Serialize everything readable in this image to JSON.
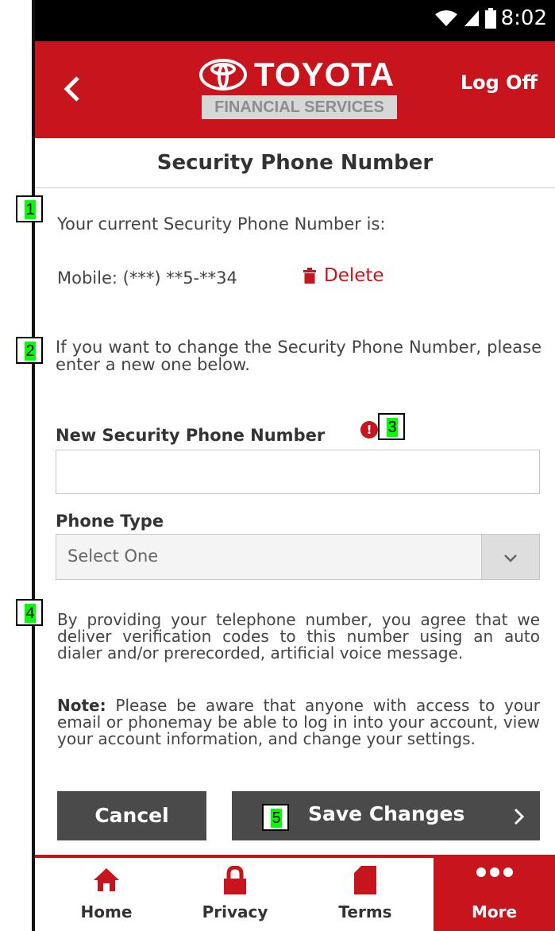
{
  "status_bar": {
    "time": "8:02"
  },
  "header": {
    "brand_name": "TOYOTA",
    "brand_sub": "FINANCIAL SERVICES",
    "logoff_label": "Log Off"
  },
  "page": {
    "title": "Security Phone Number"
  },
  "current": {
    "label": "Your current Security Phone Number is:",
    "mobile": "Mobile: (***) **5-**34",
    "delete_label": "Delete"
  },
  "change_text": "If you want to change the Security Phone Number, please enter a new one below.",
  "form": {
    "phone_label": "New Security Phone Number",
    "phone_value": "",
    "phone_type_label": "Phone Type",
    "phone_type_value": "Select One"
  },
  "consent_text": "By providing your telephone number, you agree that we deliver verification codes to this number using an auto dialer and/or prerecorded, artificial voice message.",
  "note": {
    "label": "Note:",
    "text": " Please be aware that anyone with access to your email or phonemay be able to log in into your account, view your account information, and change your settings."
  },
  "buttons": {
    "cancel": "Cancel",
    "save": "Save Changes"
  },
  "bottom_nav": [
    {
      "label": "Home",
      "icon": "home-icon"
    },
    {
      "label": "Privacy",
      "icon": "lock-icon"
    },
    {
      "label": "Terms",
      "icon": "document-icon"
    },
    {
      "label": "More",
      "icon": "more-dots-icon"
    }
  ],
  "callouts": [
    "1",
    "2",
    "3",
    "4",
    "5"
  ],
  "colors": {
    "brand_red": "#c8141c",
    "button_dark": "#4a4a4a",
    "callout_green": "#00ff00"
  }
}
